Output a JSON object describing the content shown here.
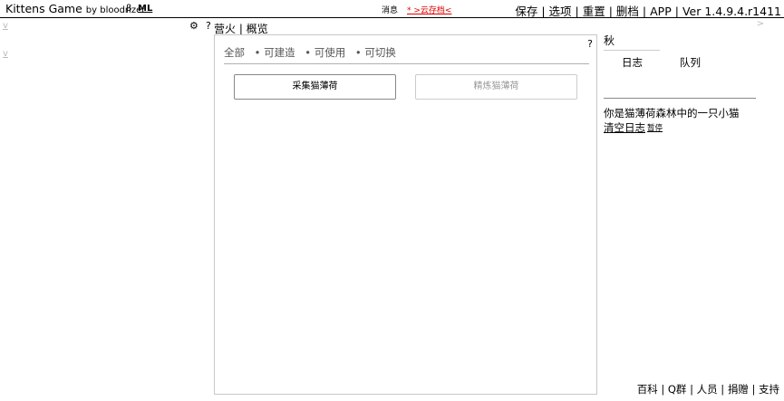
{
  "header": {
    "app_name": "Kittens Game",
    "by_text": "by bloodrizer",
    "beta": "β",
    "ml": "ML",
    "messages": "消息",
    "cloud_save": "* >云存档<",
    "menu": [
      "保存",
      "选项",
      "重置",
      "删档",
      "APP"
    ],
    "version": "Ver 1.4.9.4.r1411",
    "separator": "|"
  },
  "left": {
    "collapse_1": "v",
    "collapse_2": "v",
    "gear_icon": "⚙",
    "help": "?"
  },
  "tabs": {
    "items": [
      "营火",
      "概览"
    ],
    "separator": "|"
  },
  "main": {
    "help": "?",
    "filters": [
      "全部",
      "• 可建造",
      "• 可使用",
      "• 可切换"
    ],
    "buttons": {
      "gather": "采集猫薄荷",
      "refine": "精炼猫薄荷"
    }
  },
  "right": {
    "arrow": ">",
    "season": "秋",
    "tab_log": "日志",
    "tab_queue": "队列",
    "log_message": "你是猫薄荷森林中的一只小猫",
    "clear_log": "清空日志",
    "pause": "暂停"
  },
  "footer": {
    "links": [
      "百科",
      "Q群",
      "人员",
      "捐赠",
      "支持"
    ],
    "separator": "|"
  }
}
